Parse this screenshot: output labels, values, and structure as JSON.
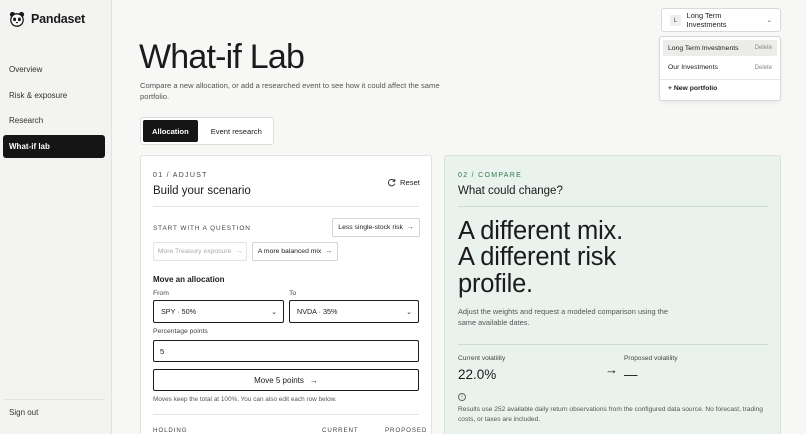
{
  "brand": {
    "name": "Pandaset",
    "logo_icon": "panda-icon"
  },
  "sidebar": {
    "items": [
      {
        "label": "Overview",
        "active": false
      },
      {
        "label": "Risk & exposure",
        "active": false
      },
      {
        "label": "Research",
        "active": false
      },
      {
        "label": "What-if lab",
        "active": true
      }
    ],
    "signout_label": "Sign out"
  },
  "header": {
    "title": "What-if Lab",
    "subtitle": "Compare a new allocation, or add a researched event to see how it could affect the same portfolio."
  },
  "mode_tabs": [
    {
      "label": "Allocation",
      "active": true
    },
    {
      "label": "Event research",
      "active": false
    }
  ],
  "portfolio_selector": {
    "avatar_letter": "L",
    "selected": "Long Term Investments",
    "options": [
      {
        "label": "Long Term Investments",
        "delete_label": "Delete",
        "active": true
      },
      {
        "label": "Our Investments",
        "delete_label": "Delete",
        "active": false
      }
    ],
    "new_label": "+ New portfolio"
  },
  "adjust": {
    "step_label": "01 / ADJUST",
    "title": "Build your scenario",
    "reset_label": "Reset",
    "question_label": "START WITH A QUESTION",
    "suggestions": [
      {
        "label": "Less single-stock risk"
      },
      {
        "label": "More Treasury exposure"
      },
      {
        "label": "A more balanced mix"
      }
    ],
    "move_title": "Move an allocation",
    "from_label": "From",
    "from_value": "SPY · 50%",
    "to_label": "To",
    "to_value": "NVDA · 35%",
    "points_label": "Percentage points",
    "points_value": "5",
    "move_button_label": "Move 5 points",
    "note": "Moves keep the total at 100%. You can also edit each row below.",
    "columns": {
      "holding": "HOLDING",
      "current": "CURRENT",
      "proposed": "PROPOSED"
    }
  },
  "compare": {
    "step_label": "02 / COMPARE",
    "title": "What could change?",
    "headline_lines": [
      "A different mix.",
      "A different risk",
      "profile."
    ],
    "text": "Adjust the weights and request a modeled comparison using the same available dates.",
    "current_label": "Current volatility",
    "current_value": "22.0%",
    "proposed_label": "Proposed volatility",
    "proposed_value": "—",
    "info_text": "Results use 252 available daily return observations from the configured data source. No forecast, trading costs, or taxes are included."
  },
  "colors": {
    "accent_green": "#2e7a4b",
    "compare_bg": "#e9f2ec",
    "active_bg": "#151515"
  }
}
